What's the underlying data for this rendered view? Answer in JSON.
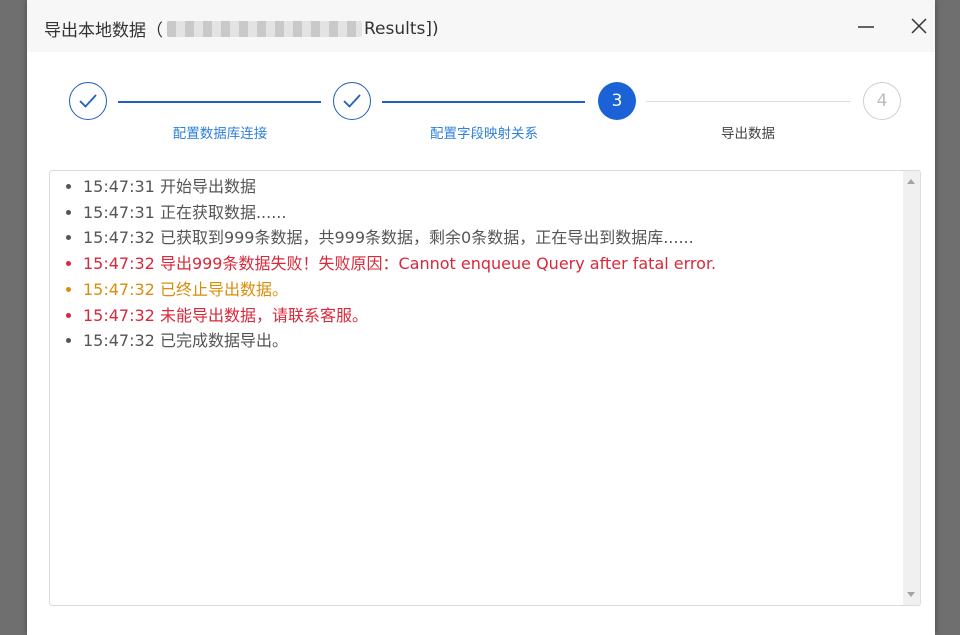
{
  "window": {
    "title_prefix": "导出本地数据（",
    "title_suffix": "Results])"
  },
  "steps": [
    {
      "number": "1",
      "label": "配置数据库连接",
      "state": "done"
    },
    {
      "number": "2",
      "label": "配置字段映射关系",
      "state": "done"
    },
    {
      "number": "3",
      "label": "导出数据",
      "state": "active"
    },
    {
      "number": "4",
      "label": "",
      "state": "todo"
    }
  ],
  "log": [
    {
      "text": "15:47:31 开始导出数据",
      "level": "normal"
    },
    {
      "text": "15:47:31 正在获取数据......",
      "level": "normal"
    },
    {
      "text": "15:47:32 已获取到999条数据，共999条数据，剩余0条数据，正在导出到数据库......",
      "level": "normal"
    },
    {
      "text": "15:47:32 导出999条数据失败！失败原因：Cannot enqueue Query after fatal error.",
      "level": "error"
    },
    {
      "text": "15:47:32 已终止导出数据。",
      "level": "warn"
    },
    {
      "text": "15:47:32 未能导出数据，请联系客服。",
      "level": "error"
    },
    {
      "text": "15:47:32 已完成数据导出。",
      "level": "normal"
    }
  ],
  "colors": {
    "primary": "#1a62d6",
    "done_line": "#1f5fbf",
    "done_label": "#2f7fd8",
    "error": "#d8283a",
    "warn": "#d98e0a",
    "normal": "#555555"
  }
}
